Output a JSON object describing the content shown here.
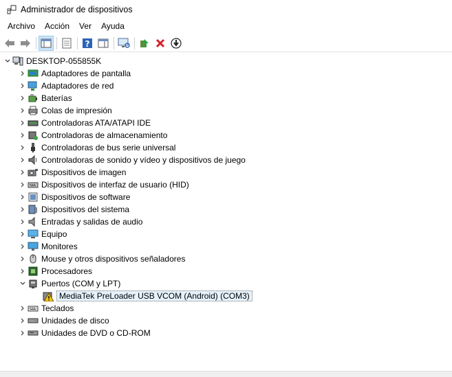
{
  "window": {
    "title": "Administrador de dispositivos"
  },
  "menu": [
    "Archivo",
    "Acción",
    "Ver",
    "Ayuda"
  ],
  "toolbar": {
    "buttons": [
      "back-icon",
      "forward-icon",
      "sep",
      "properties-view-icon",
      "sep",
      "list-view-icon",
      "sep",
      "help-icon",
      "console-icon",
      "sep",
      "monitor-scan-icon",
      "sep",
      "update-driver-icon",
      "uninstall-icon",
      "download-icon"
    ]
  },
  "tree": {
    "root": "DESKTOP-055855K",
    "categories": [
      {
        "label": "Adaptadores de pantalla",
        "icon": "display-adapter-icon"
      },
      {
        "label": "Adaptadores de red",
        "icon": "network-adapter-icon"
      },
      {
        "label": "Baterías",
        "icon": "battery-icon"
      },
      {
        "label": "Colas de impresión",
        "icon": "print-queue-icon"
      },
      {
        "label": "Controladoras ATA/ATAPI IDE",
        "icon": "ide-controller-icon"
      },
      {
        "label": "Controladoras de almacenamiento",
        "icon": "storage-controller-icon"
      },
      {
        "label": "Controladoras de bus serie universal",
        "icon": "usb-icon"
      },
      {
        "label": "Controladoras de sonido y vídeo y dispositivos de juego",
        "icon": "sound-icon"
      },
      {
        "label": "Dispositivos de imagen",
        "icon": "camera-icon"
      },
      {
        "label": "Dispositivos de interfaz de usuario (HID)",
        "icon": "hid-icon"
      },
      {
        "label": "Dispositivos de software",
        "icon": "software-device-icon"
      },
      {
        "label": "Dispositivos del sistema",
        "icon": "system-device-icon"
      },
      {
        "label": "Entradas y salidas de audio",
        "icon": "audio-io-icon"
      },
      {
        "label": "Equipo",
        "icon": "computer-icon"
      },
      {
        "label": "Monitores",
        "icon": "monitor-icon"
      },
      {
        "label": "Mouse y otros dispositivos señaladores",
        "icon": "mouse-icon"
      },
      {
        "label": "Procesadores",
        "icon": "processor-icon"
      },
      {
        "label": "Puertos (COM y LPT)",
        "icon": "port-icon",
        "expanded": true,
        "children": [
          {
            "label": "MediaTek PreLoader USB VCOM (Android) (COM3)",
            "icon": "warning-icon"
          }
        ]
      },
      {
        "label": "Teclados",
        "icon": "keyboard-icon"
      },
      {
        "label": "Unidades de disco",
        "icon": "disk-drive-icon"
      },
      {
        "label": "Unidades de DVD o CD-ROM",
        "icon": "dvd-icon"
      }
    ]
  }
}
